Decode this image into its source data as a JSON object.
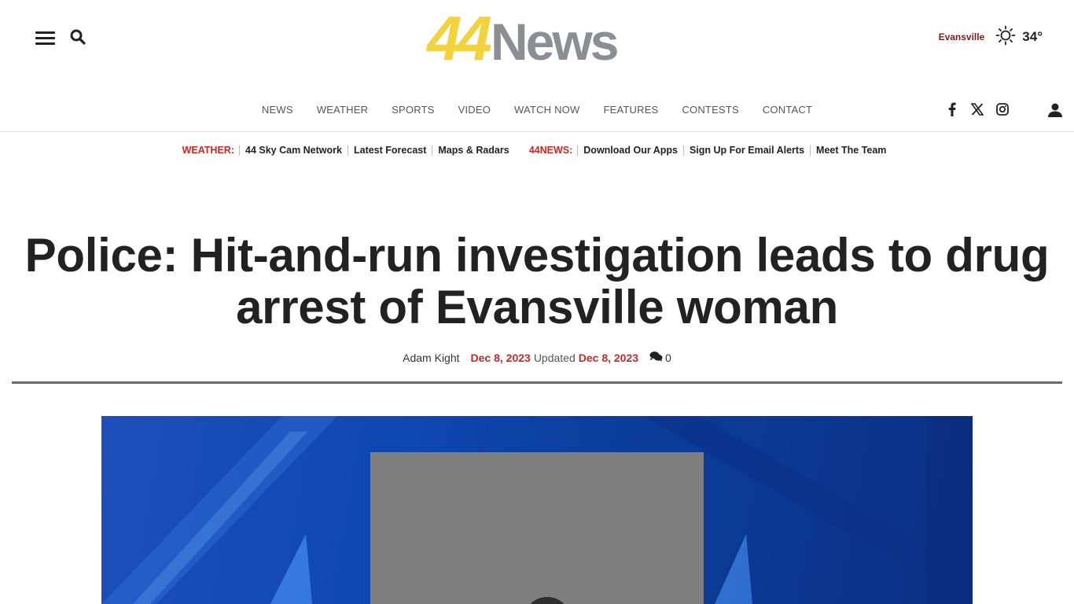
{
  "header": {
    "logo_number": "44",
    "logo_word": "News",
    "weather": {
      "city": "Evansville",
      "temperature": "34°",
      "condition_icon": "sun-icon"
    }
  },
  "nav": {
    "items": [
      "NEWS",
      "WEATHER",
      "SPORTS",
      "VIDEO",
      "WATCH NOW",
      "FEATURES",
      "CONTESTS",
      "CONTACT"
    ],
    "social": [
      "facebook-icon",
      "x-icon",
      "instagram-icon"
    ],
    "user_icon": "user-icon"
  },
  "subnav": {
    "weather_label": "WEATHER:",
    "weather_links": [
      "44 Sky Cam Network",
      "Latest Forecast",
      "Maps & Radars"
    ],
    "news_label": "44NEWS:",
    "news_links": [
      "Download Our Apps",
      "Sign Up For Email Alerts",
      "Meet The Team"
    ]
  },
  "article": {
    "headline": "Police: Hit-and-run investigation leads to drug arrest of Evansville woman",
    "author": "Adam Kight",
    "published": "Dec 8, 2023",
    "updated_label": "Updated",
    "updated": "Dec 8, 2023",
    "comment_count": "0"
  },
  "colors": {
    "logo_yellow": "#f2d33c",
    "logo_gray": "#8b8e92",
    "accent_red": "#c62828",
    "hero_blue": "#0e47b0"
  }
}
